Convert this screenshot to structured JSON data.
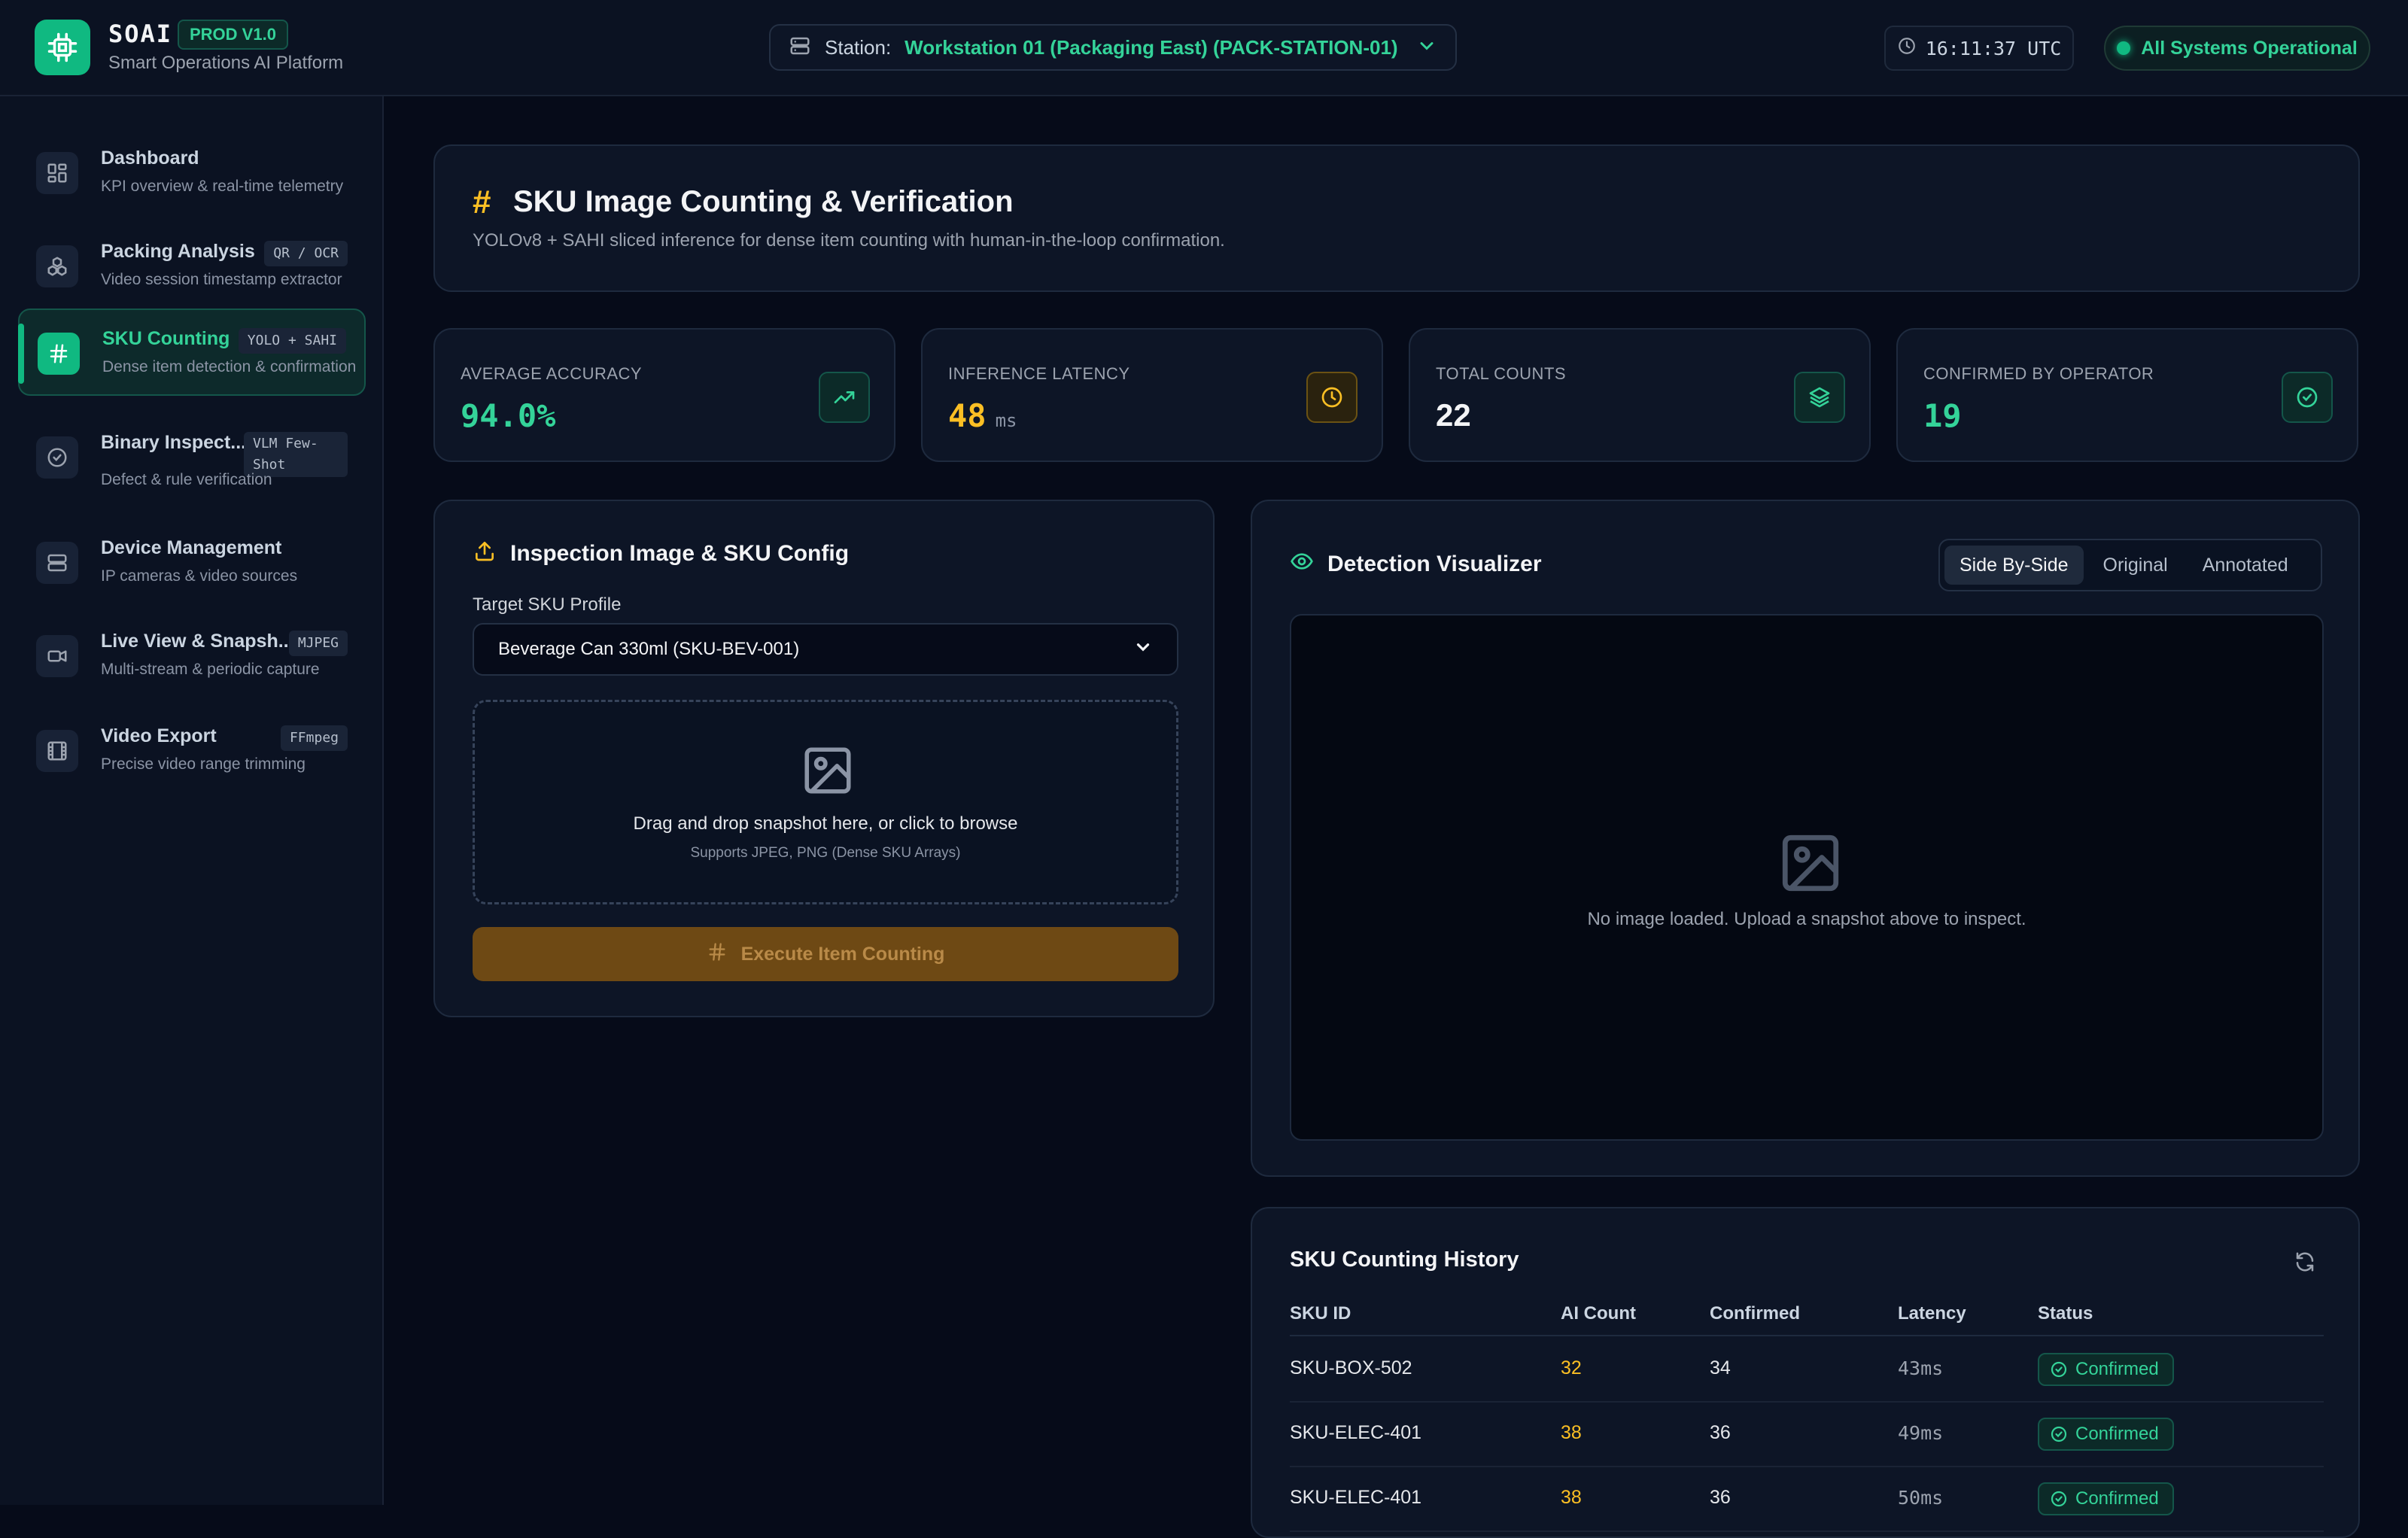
{
  "header": {
    "brand_name": "SOAI",
    "brand_badge": "PROD V1.0",
    "brand_subtitle": "Smart Operations AI Platform",
    "station_label": "Station:",
    "station_value": "Workstation 01 (Packaging East) (PACK-STATION-01)",
    "clock": "16:11:37 UTC",
    "system_status": "All Systems Operational"
  },
  "sidebar": {
    "items": [
      {
        "title": "Dashboard",
        "subtitle": "KPI overview & real-time telemetry",
        "tag": ""
      },
      {
        "title": "Packing Analysis",
        "subtitle": "Video session timestamp extractor",
        "tag": "QR / OCR"
      },
      {
        "title": "SKU Counting",
        "subtitle": "Dense item detection & confirmation",
        "tag": "YOLO + SAHI"
      },
      {
        "title": "Binary Inspect...",
        "subtitle": "Defect & rule verification",
        "tag": "VLM Few-Shot"
      },
      {
        "title": "Device Management",
        "subtitle": "IP cameras & video sources",
        "tag": ""
      },
      {
        "title": "Live View & Snapsh...",
        "subtitle": "Multi-stream & periodic capture",
        "tag": "MJPEG"
      },
      {
        "title": "Video Export",
        "subtitle": "Precise video range trimming",
        "tag": "FFmpeg"
      }
    ]
  },
  "page": {
    "hash": "#",
    "title": "SKU Image Counting & Verification",
    "subtitle": "YOLOv8 + SAHI sliced inference for dense item counting with human-in-the-loop confirmation."
  },
  "kpis": [
    {
      "label": "AVERAGE ACCURACY",
      "value": "94.0%",
      "unit": "",
      "color": "#34d399"
    },
    {
      "label": "INFERENCE LATENCY",
      "value": "48",
      "unit": "ms",
      "color": "#fbbf24"
    },
    {
      "label": "TOTAL COUNTS",
      "value": "22",
      "unit": "",
      "color": "#f3f4f6"
    },
    {
      "label": "CONFIRMED BY OPERATOR",
      "value": "19",
      "unit": "",
      "color": "#34d399"
    }
  ],
  "config": {
    "title": "Inspection Image & SKU Config",
    "sku_label": "Target SKU Profile",
    "sku_selected": "Beverage Can 330ml (SKU-BEV-001)",
    "dropzone_text": "Drag and drop snapshot here, or click to browse",
    "dropzone_sub": "Supports JPEG, PNG (Dense SKU Arrays)",
    "execute_label": "Execute Item Counting"
  },
  "visualizer": {
    "title": "Detection Visualizer",
    "modes": [
      "Side By-Side",
      "Original",
      "Annotated"
    ],
    "active_mode": "Side By-Side",
    "empty_text": "No image loaded. Upload a snapshot above to inspect."
  },
  "history": {
    "title": "SKU Counting History",
    "columns": [
      "SKU ID",
      "AI Count",
      "Confirmed",
      "Latency",
      "Status"
    ],
    "rows": [
      {
        "sku": "SKU-BOX-502",
        "ai": "32",
        "confirmed": "34",
        "latency": "43ms",
        "status": "Confirmed"
      },
      {
        "sku": "SKU-ELEC-401",
        "ai": "38",
        "confirmed": "36",
        "latency": "49ms",
        "status": "Confirmed"
      },
      {
        "sku": "SKU-ELEC-401",
        "ai": "38",
        "confirmed": "36",
        "latency": "50ms",
        "status": "Confirmed"
      }
    ]
  },
  "colors": {
    "accent": "#10b981",
    "accent_text": "#34d399",
    "warning": "#fbbf24",
    "background": "#060b19",
    "panel": "#0d1526"
  },
  "icons": {
    "logo": "cpu-chip-icon",
    "station": "server-icon",
    "clock": "clock-icon",
    "accuracy": "trending-up-icon",
    "latency": "clock-icon",
    "counts": "layers-icon",
    "confirmed": "check-circle-icon",
    "upload": "upload-icon",
    "image": "image-icon",
    "eye": "eye-icon",
    "refresh": "refresh-icon"
  }
}
